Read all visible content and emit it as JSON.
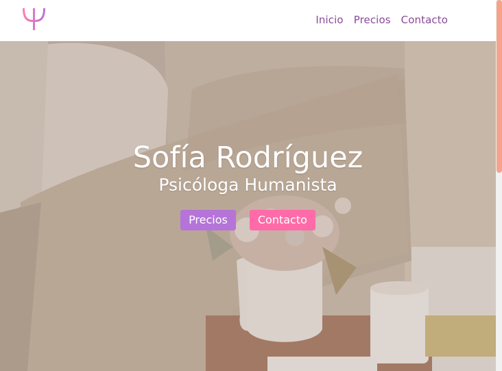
{
  "brand": {
    "logo_icon": "psi-icon",
    "logo_gradient": [
      "#ff7db0",
      "#b574d8"
    ]
  },
  "nav": {
    "items": [
      {
        "label": "Inicio"
      },
      {
        "label": "Precios"
      },
      {
        "label": "Contacto"
      }
    ]
  },
  "hero": {
    "name": "Sofía Rodríguez",
    "subtitle": "Psicóloga Humanista",
    "buttons": [
      {
        "label": "Precios",
        "color": "#b574d8"
      },
      {
        "label": "Contacto",
        "color": "#ff6ba8"
      }
    ]
  },
  "colors": {
    "nav_text": "#8a4a9a",
    "scroll_thumb": "#f4a48a"
  }
}
